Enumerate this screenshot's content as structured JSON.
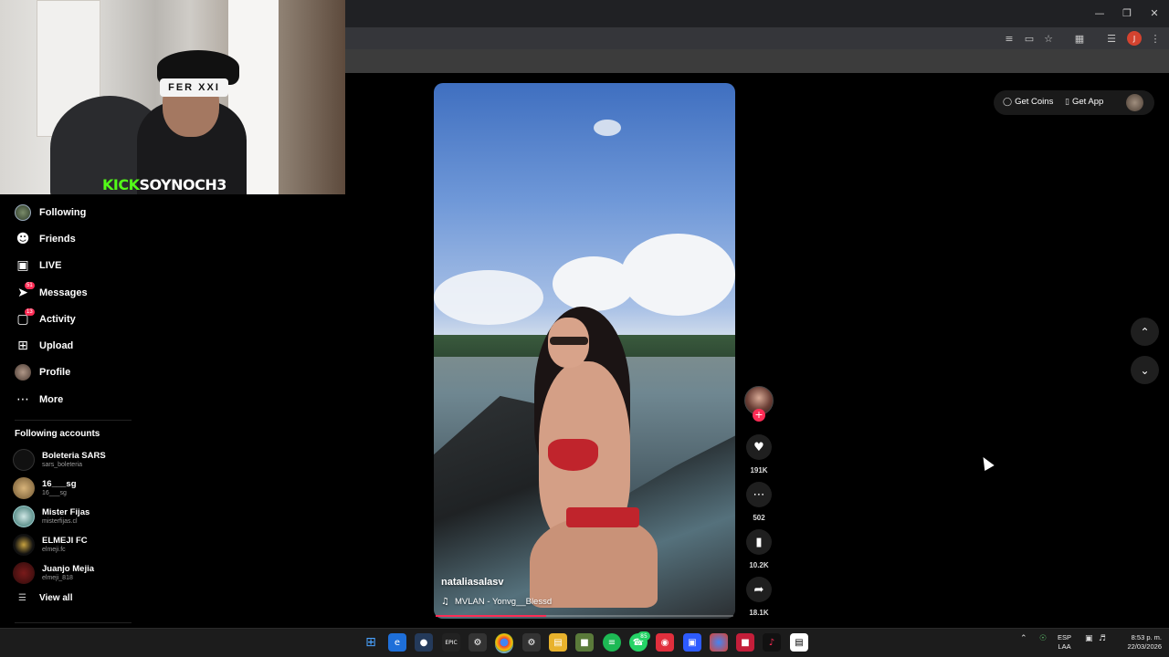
{
  "webcam": {
    "brand_prefix": "KICK",
    "brand_name": "SOYNOCH3",
    "glasses_text": "FER XXI"
  },
  "sidebar": {
    "items": [
      {
        "label": "Following",
        "icon": "following-avatar-icon"
      },
      {
        "label": "Friends",
        "icon": "friends-icon"
      },
      {
        "label": "LIVE",
        "icon": "live-icon"
      },
      {
        "label": "Messages",
        "icon": "messages-icon",
        "badge": "51"
      },
      {
        "label": "Activity",
        "icon": "activity-icon",
        "badge": "13"
      },
      {
        "label": "Upload",
        "icon": "upload-icon"
      },
      {
        "label": "Profile",
        "icon": "profile-avatar-icon"
      },
      {
        "label": "More",
        "icon": "more-icon"
      }
    ],
    "following_title": "Following accounts",
    "accounts": [
      {
        "name": "Boleteria SARS",
        "handle": "sars_boleteria"
      },
      {
        "name": "16___sg",
        "handle": "16___sg"
      },
      {
        "name": "Mister Fijas",
        "handle": "misterfijas.cl"
      },
      {
        "name": "ELMEJI FC",
        "handle": "elmeji.fc"
      },
      {
        "name": "Juanjo Mejia",
        "handle": "elmeji_818"
      }
    ],
    "view_all": "View all"
  },
  "video": {
    "username": "nataliasalasv",
    "music": "MVLAN - Yonvg__Blessd",
    "progress": 0.37
  },
  "actions": {
    "likes": "191K",
    "comments": "502",
    "saves": "10.2K",
    "shares": "18.1K"
  },
  "header": {
    "get_coins": "Get Coins",
    "get_app": "Get App"
  },
  "taskbar": {
    "whatsapp_badge": "85",
    "language_line1": "ESP",
    "language_line2": "LAA",
    "time": "8:53 p. m.",
    "date": "22/03/2026"
  },
  "colors": {
    "accent": "#fe2c55",
    "kick_green": "#53fc18",
    "background": "#000000"
  }
}
